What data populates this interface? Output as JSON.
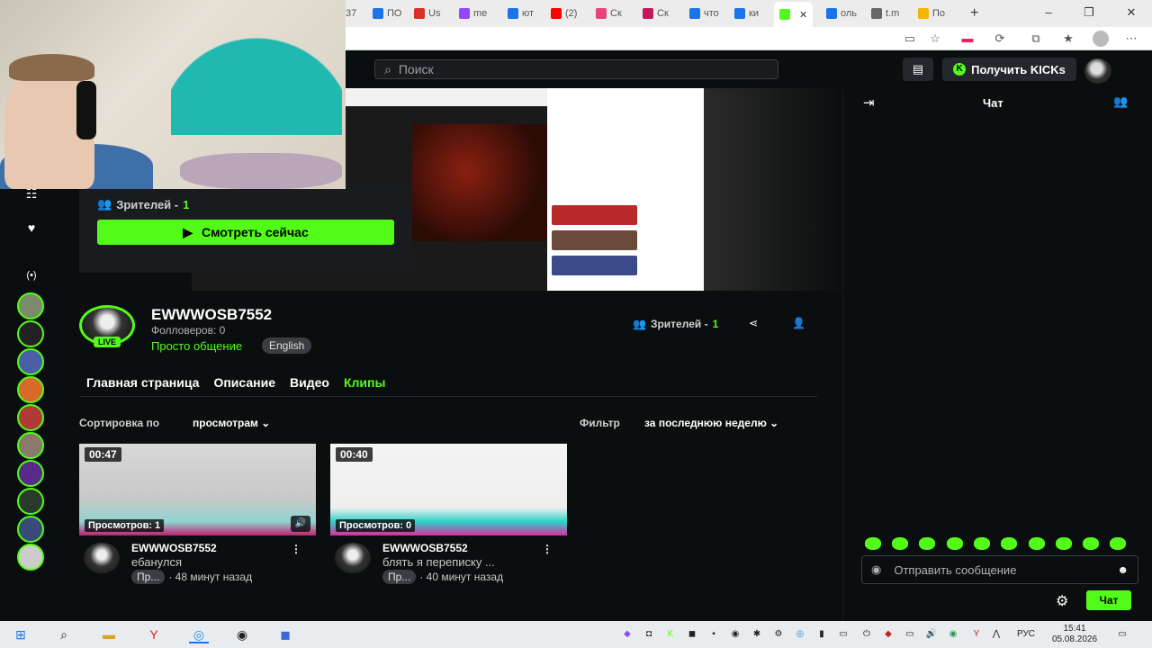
{
  "browser": {
    "tabs": [
      {
        "label": "37",
        "color": "#888"
      },
      {
        "label": "ПО",
        "color": "#1a73e8"
      },
      {
        "label": "Us",
        "color": "#d93025"
      },
      {
        "label": "me",
        "color": "#9146ff"
      },
      {
        "label": "ют",
        "color": "#1a73e8"
      },
      {
        "label": "(2)",
        "color": "#ff0000"
      },
      {
        "label": "Ск",
        "color": "#e8437a"
      },
      {
        "label": "Ск",
        "color": "#c2185b"
      },
      {
        "label": "что",
        "color": "#1a73e8"
      },
      {
        "label": "ки",
        "color": "#1a73e8"
      },
      {
        "label": "",
        "color": "#53fc18"
      },
      {
        "label": "оль",
        "color": "#1a73e8"
      },
      {
        "label": "t.m",
        "color": "#666"
      },
      {
        "label": "По",
        "color": "#f4b400"
      }
    ],
    "new_tab": "+",
    "minimize": "–",
    "maximize": "❐",
    "close": "✕"
  },
  "header": {
    "search_placeholder": "Поиск",
    "get_kicks": "Получить KICKs",
    "kick_letter": "K"
  },
  "popup": {
    "viewers_label": "Зрителей -",
    "viewers_count": "1",
    "watch_now": "Смотреть сейчас"
  },
  "channel": {
    "name": "EWWWOSB7552",
    "live": "LIVE",
    "followers": "Фолловеров: 0",
    "category": "Просто общение",
    "language": "English",
    "viewers_label": "Зрителей -",
    "viewers_count": "1"
  },
  "tabs": [
    "Главная страница",
    "Описание",
    "Видео",
    "Клипы"
  ],
  "sort": {
    "label": "Сортировка по",
    "value": "просмотрам"
  },
  "filter": {
    "label": "Фильтр",
    "value": "за последнюю неделю"
  },
  "clips": [
    {
      "duration": "00:47",
      "views": "Просмотров: 1",
      "channel": "EWWWOSB7552",
      "title": "ебанулся",
      "category": "Пр...",
      "time": "· 48 минут назад"
    },
    {
      "duration": "00:40",
      "views": "Просмотров: 0",
      "channel": "EWWWOSB7552",
      "title": "блять я переписку ...",
      "category": "Пр...",
      "time": "· 40 минут назад"
    }
  ],
  "chat": {
    "title": "Чат",
    "placeholder": "Отправить сообщение",
    "send": "Чат"
  },
  "taskbar": {
    "lang": "РУС",
    "time": "15:41",
    "date": "05.08.2026"
  },
  "colors": {
    "accent": "#53fc18",
    "background": "#0b0e0f"
  }
}
